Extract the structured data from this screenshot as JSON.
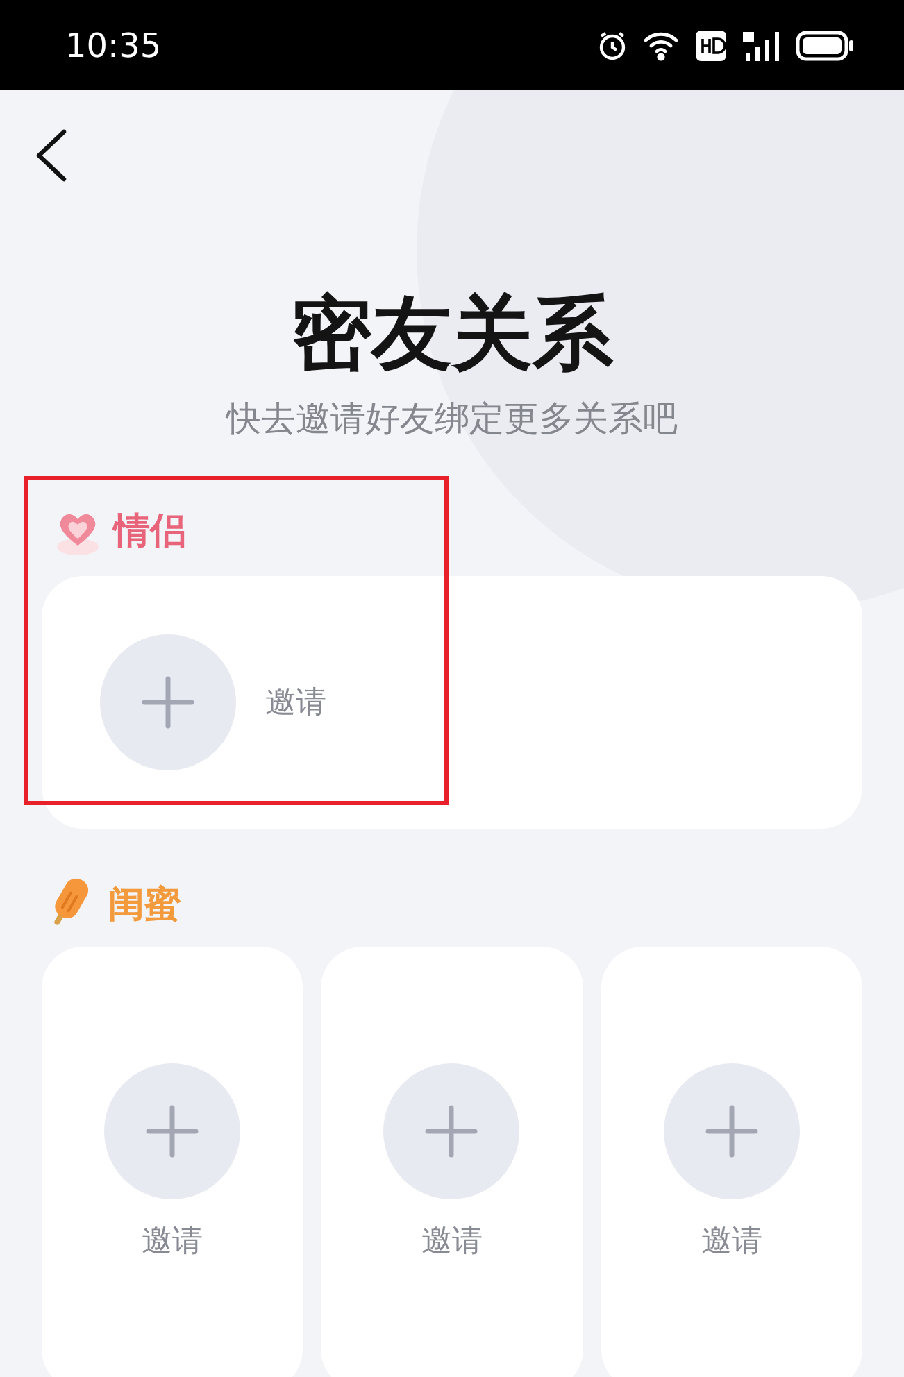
{
  "status_bar": {
    "time": "10:35"
  },
  "title": "密友关系",
  "subtitle": "快去邀请好友绑定更多关系吧",
  "sections": [
    {
      "kind": "couple",
      "label": "情侣",
      "color": "#e8647a",
      "highlighted": true,
      "slots": [
        {
          "label": "邀请"
        }
      ]
    },
    {
      "kind": "bestie",
      "label": "闺蜜",
      "color": "#f29a3c",
      "highlighted": false,
      "slots": [
        {
          "label": "邀请"
        },
        {
          "label": "邀请"
        },
        {
          "label": "邀请"
        }
      ]
    }
  ]
}
